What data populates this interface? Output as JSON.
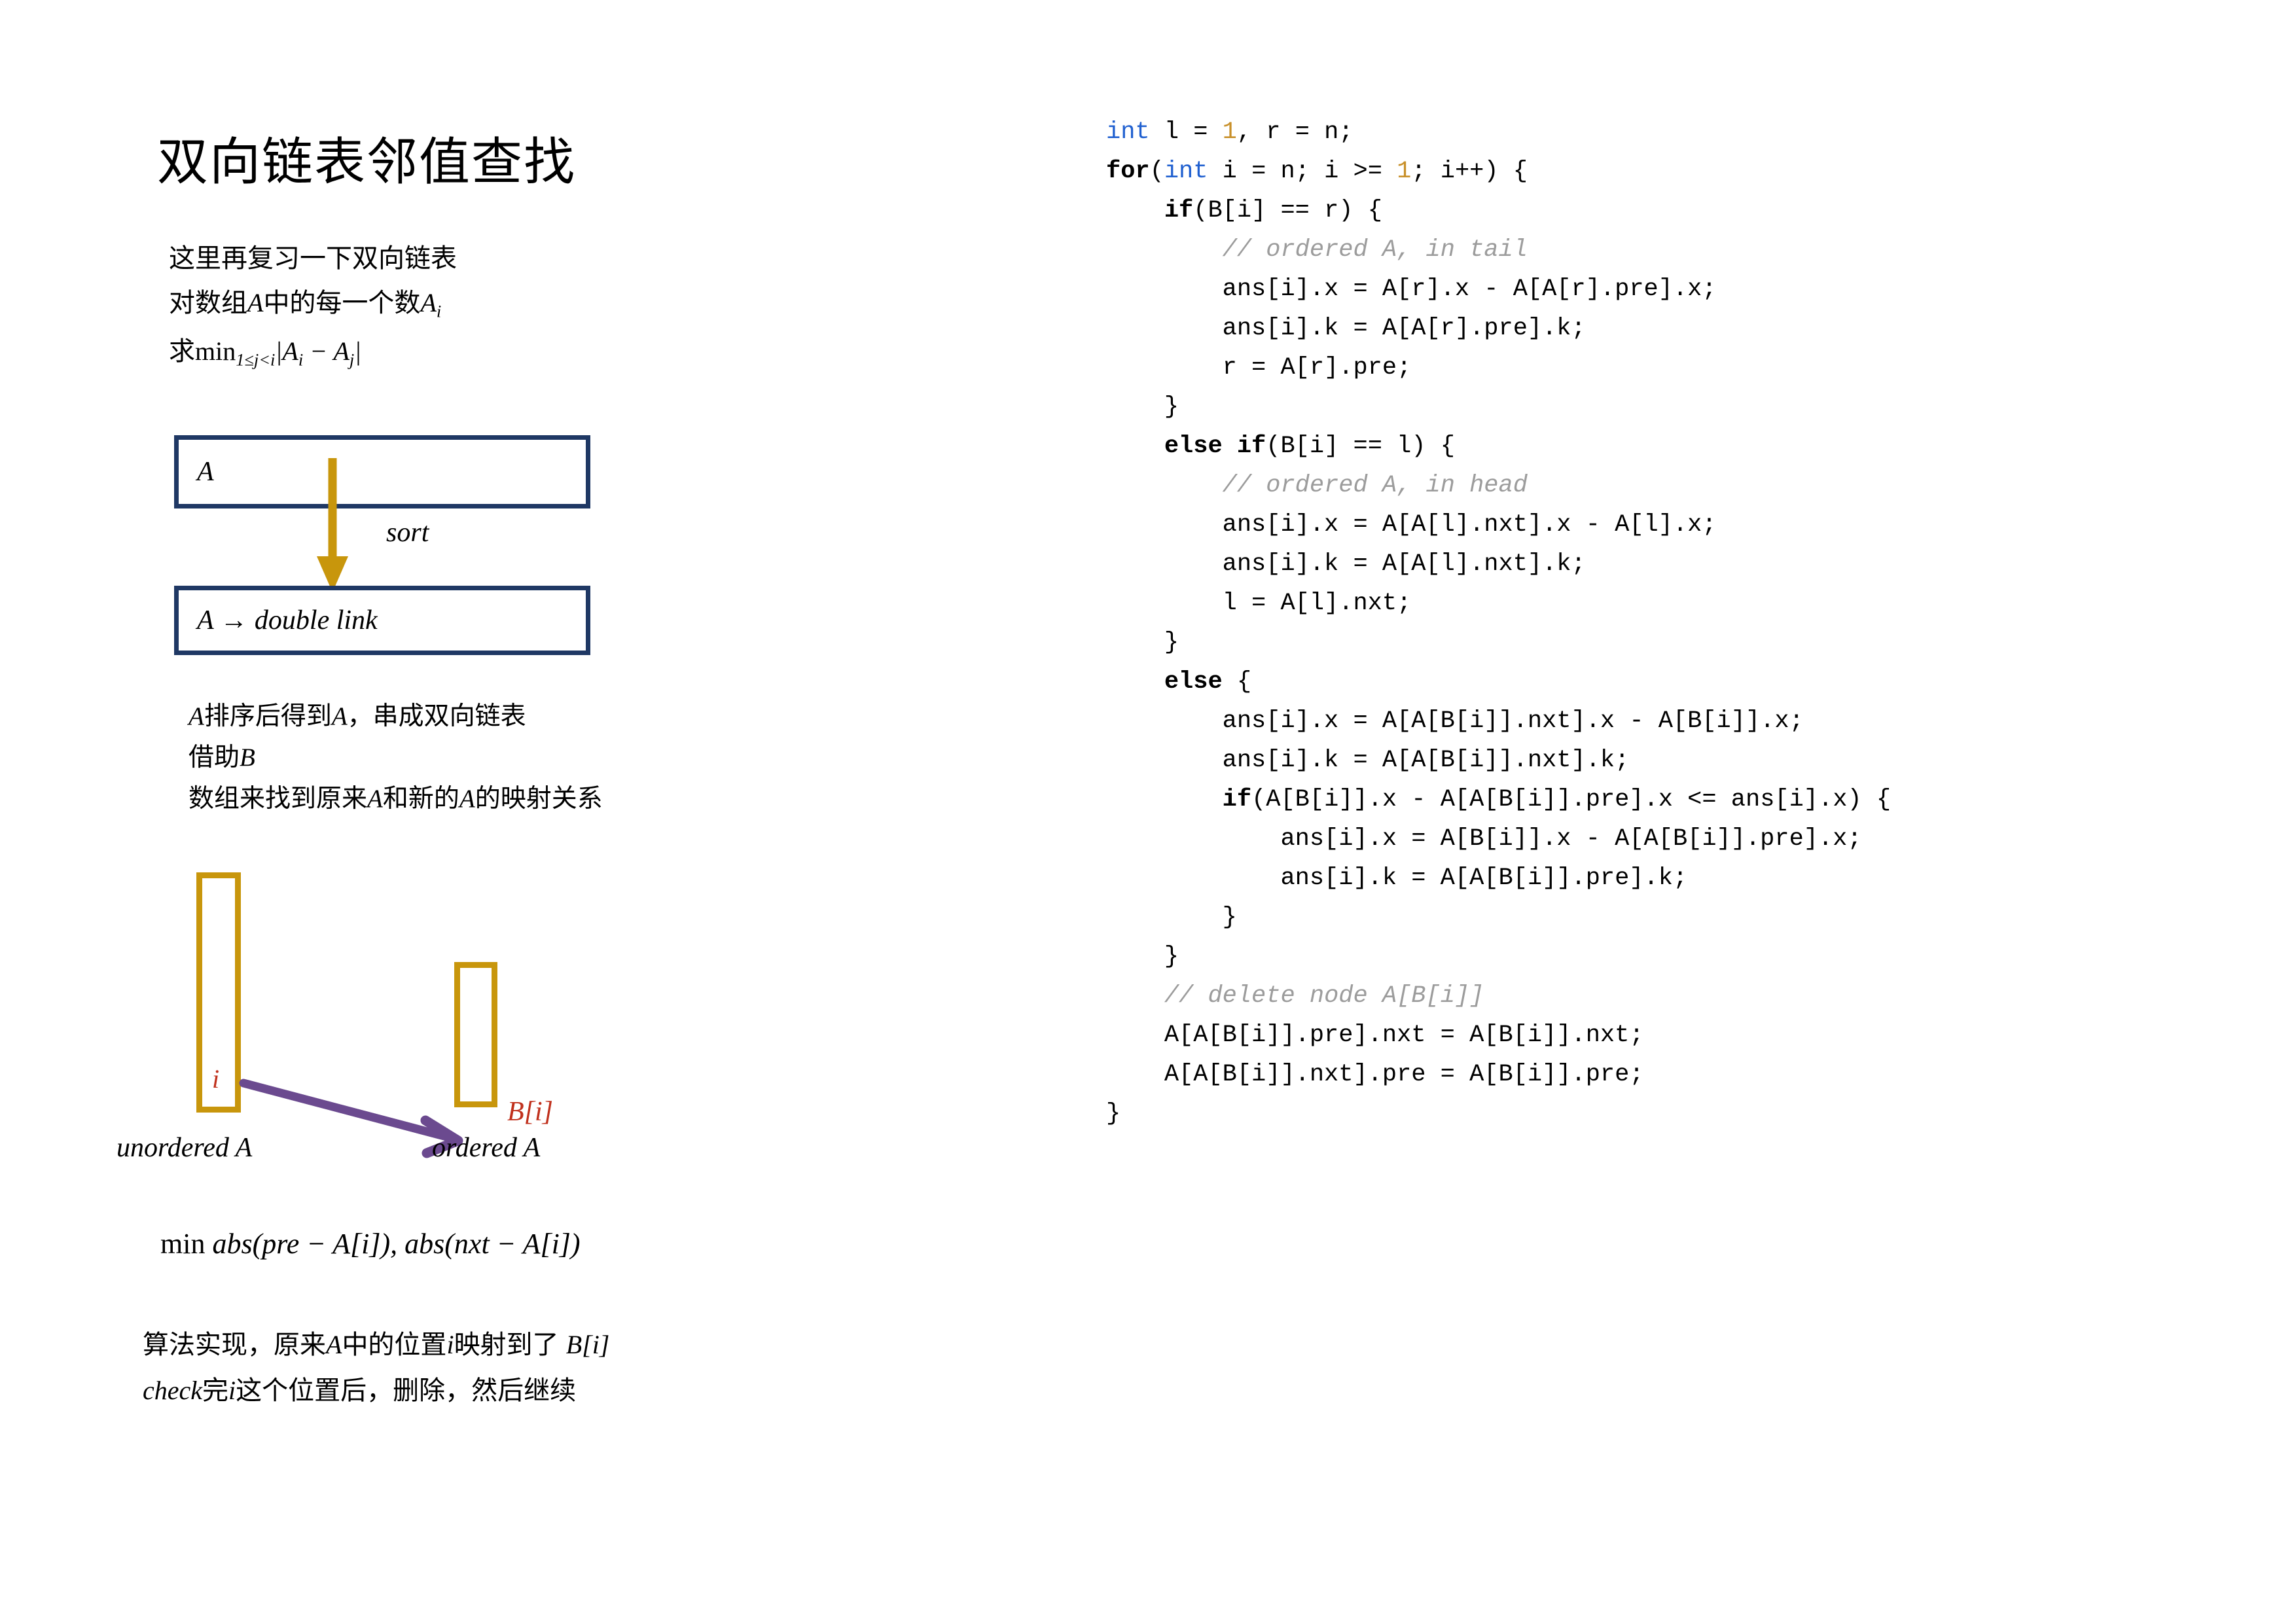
{
  "slide": {
    "title": "双向链表邻值查找"
  },
  "intro": {
    "lines": [
      "这里再复习一下双向链表",
      "对数组A中的每一个数Aᵢ",
      "求min₁≤ⱼ<ᵢ |Aᵢ − Aⱼ|"
    ],
    "line1": "这里再复习一下双向链表",
    "line2_pre": "对数组",
    "line2_var": "A",
    "line2_mid": "中的每一个数",
    "line2_var2": "A",
    "line2_sub": "i",
    "line3_pre": "求",
    "line3_min": "min",
    "line3_range": "1≤j<i",
    "line3_expr": "|A",
    "line3_sub1": "i",
    "line3_minus": " − A",
    "line3_sub2": "j",
    "line3_end": "|"
  },
  "flow": {
    "box_a_label": "A",
    "box_doublelink_label": "A → double link",
    "sort_label": "sort"
  },
  "explain": {
    "line1_pre": "A",
    "line1_mid": "排序后得到",
    "line1_var": "A",
    "line1_post": "，串成双向链表",
    "line2_pre": "借助",
    "line2_var": "B",
    "line3_pre": "数组来找到原来",
    "line3_var1": "A",
    "line3_mid": "和新的",
    "line3_var2": "A",
    "line3_post": "的映射关系"
  },
  "mapping": {
    "label_i": "i",
    "label_bi": "B[i]",
    "caption_unordered": "unordered A",
    "caption_ordered": "ordered A"
  },
  "formula": {
    "min_text": "min ",
    "body": "abs(pre − A[i]), abs(nxt − A[i])"
  },
  "footer": {
    "line1_pre": "算法实现，原来",
    "line1_var1": "A",
    "line1_mid": "中的位置",
    "line1_var2": "i",
    "line1_post": "映射到了 ",
    "line1_var3": "B[i]",
    "line2_pre": "check",
    "line2_mid": "完",
    "line2_var": "i",
    "line2_post": "这个位置后，删除，然后继续"
  },
  "code": {
    "language": "cpp",
    "lines": [
      "int l = 1, r = n;",
      "for(int i = n; i >= 1; i++) {",
      "    if(B[i] == r) {",
      "        // ordered A, in tail",
      "        ans[i].x = A[r].x - A[A[r].pre].x;",
      "        ans[i].k = A[A[r].pre].k;",
      "        r = A[r].pre;",
      "    }",
      "    else if(B[i] == l) {",
      "        // ordered A, in head",
      "        ans[i].x = A[A[l].nxt].x - A[l].x;",
      "        ans[i].k = A[A[l].nxt].k;",
      "        l = A[l].nxt;",
      "    }",
      "    else {",
      "        ans[i].x = A[A[B[i]].nxt].x - A[B[i]].x;",
      "        ans[i].k = A[A[B[i]].nxt].k;",
      "        if(A[B[i]].x - A[A[B[i]].pre].x <= ans[i].x) {",
      "            ans[i].x = A[B[i]].x - A[A[B[i]].pre].x;",
      "            ans[i].k = A[A[B[i]].pre].k;",
      "        }",
      "    }",
      "    // delete node A[B[i]]",
      "    A[A[B[i]].pre].nxt = A[B[i]].nxt;",
      "    A[A[B[i]].nxt].pre = A[B[i]].pre;",
      "}"
    ]
  },
  "colors": {
    "navy_border": "#1f3864",
    "gold": "#c8960c",
    "purple_arrow": "#6b4a8f",
    "red_label": "#c0301c",
    "code_keyword_type": "#2060d0",
    "code_number": "#c8902a",
    "code_comment": "#9c9c9c",
    "text": "#000000",
    "background": "#ffffff"
  }
}
